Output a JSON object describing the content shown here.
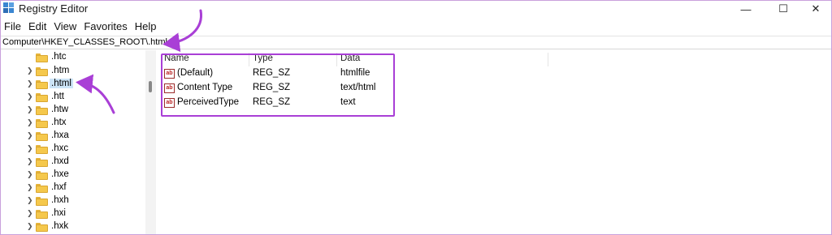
{
  "window": {
    "title": "Registry Editor",
    "minimize_glyph": "—",
    "maximize_glyph": "☐",
    "close_glyph": "✕"
  },
  "menu": [
    "File",
    "Edit",
    "View",
    "Favorites",
    "Help"
  ],
  "address": "Computer\\HKEY_CLASSES_ROOT\\.html",
  "tree": {
    "selected": ".html",
    "items": [
      ".htc",
      ".htm",
      ".html",
      ".htt",
      ".htw",
      ".htx",
      ".hxa",
      ".hxc",
      ".hxd",
      ".hxe",
      ".hxf",
      ".hxh",
      ".hxi",
      ".hxk"
    ]
  },
  "list": {
    "columns": [
      "Name",
      "Type",
      "Data"
    ],
    "rows": [
      {
        "name": "(Default)",
        "type": "REG_SZ",
        "data": "htmlfile"
      },
      {
        "name": "Content Type",
        "type": "REG_SZ",
        "data": "text/html"
      },
      {
        "name": "PerceivedType",
        "type": "REG_SZ",
        "data": "text"
      }
    ],
    "value_icon_text": "ab"
  },
  "annotation_color": "#a93fd6",
  "folder_color": "#f5c84c",
  "selection_color": "#cce4f7"
}
